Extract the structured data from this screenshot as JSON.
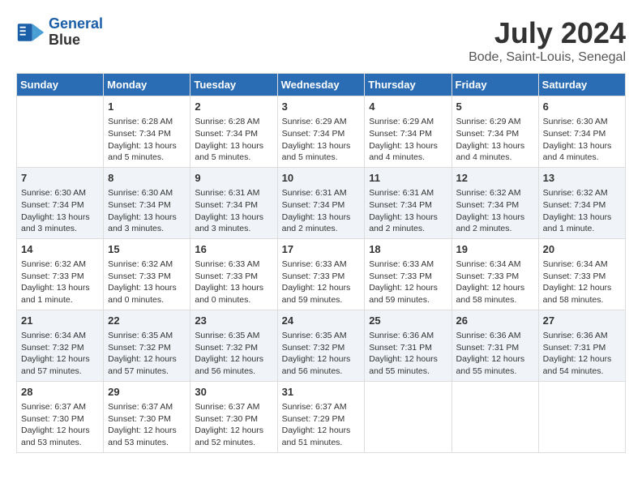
{
  "header": {
    "logo_line1": "General",
    "logo_line2": "Blue",
    "month_year": "July 2024",
    "location": "Bode, Saint-Louis, Senegal"
  },
  "days_of_week": [
    "Sunday",
    "Monday",
    "Tuesday",
    "Wednesday",
    "Thursday",
    "Friday",
    "Saturday"
  ],
  "weeks": [
    [
      {
        "day": "",
        "text": ""
      },
      {
        "day": "1",
        "text": "Sunrise: 6:28 AM\nSunset: 7:34 PM\nDaylight: 13 hours\nand 5 minutes."
      },
      {
        "day": "2",
        "text": "Sunrise: 6:28 AM\nSunset: 7:34 PM\nDaylight: 13 hours\nand 5 minutes."
      },
      {
        "day": "3",
        "text": "Sunrise: 6:29 AM\nSunset: 7:34 PM\nDaylight: 13 hours\nand 5 minutes."
      },
      {
        "day": "4",
        "text": "Sunrise: 6:29 AM\nSunset: 7:34 PM\nDaylight: 13 hours\nand 4 minutes."
      },
      {
        "day": "5",
        "text": "Sunrise: 6:29 AM\nSunset: 7:34 PM\nDaylight: 13 hours\nand 4 minutes."
      },
      {
        "day": "6",
        "text": "Sunrise: 6:30 AM\nSunset: 7:34 PM\nDaylight: 13 hours\nand 4 minutes."
      }
    ],
    [
      {
        "day": "7",
        "text": "Sunrise: 6:30 AM\nSunset: 7:34 PM\nDaylight: 13 hours\nand 3 minutes."
      },
      {
        "day": "8",
        "text": "Sunrise: 6:30 AM\nSunset: 7:34 PM\nDaylight: 13 hours\nand 3 minutes."
      },
      {
        "day": "9",
        "text": "Sunrise: 6:31 AM\nSunset: 7:34 PM\nDaylight: 13 hours\nand 3 minutes."
      },
      {
        "day": "10",
        "text": "Sunrise: 6:31 AM\nSunset: 7:34 PM\nDaylight: 13 hours\nand 2 minutes."
      },
      {
        "day": "11",
        "text": "Sunrise: 6:31 AM\nSunset: 7:34 PM\nDaylight: 13 hours\nand 2 minutes."
      },
      {
        "day": "12",
        "text": "Sunrise: 6:32 AM\nSunset: 7:34 PM\nDaylight: 13 hours\nand 2 minutes."
      },
      {
        "day": "13",
        "text": "Sunrise: 6:32 AM\nSunset: 7:34 PM\nDaylight: 13 hours\nand 1 minute."
      }
    ],
    [
      {
        "day": "14",
        "text": "Sunrise: 6:32 AM\nSunset: 7:33 PM\nDaylight: 13 hours\nand 1 minute."
      },
      {
        "day": "15",
        "text": "Sunrise: 6:32 AM\nSunset: 7:33 PM\nDaylight: 13 hours\nand 0 minutes."
      },
      {
        "day": "16",
        "text": "Sunrise: 6:33 AM\nSunset: 7:33 PM\nDaylight: 13 hours\nand 0 minutes."
      },
      {
        "day": "17",
        "text": "Sunrise: 6:33 AM\nSunset: 7:33 PM\nDaylight: 12 hours\nand 59 minutes."
      },
      {
        "day": "18",
        "text": "Sunrise: 6:33 AM\nSunset: 7:33 PM\nDaylight: 12 hours\nand 59 minutes."
      },
      {
        "day": "19",
        "text": "Sunrise: 6:34 AM\nSunset: 7:33 PM\nDaylight: 12 hours\nand 58 minutes."
      },
      {
        "day": "20",
        "text": "Sunrise: 6:34 AM\nSunset: 7:33 PM\nDaylight: 12 hours\nand 58 minutes."
      }
    ],
    [
      {
        "day": "21",
        "text": "Sunrise: 6:34 AM\nSunset: 7:32 PM\nDaylight: 12 hours\nand 57 minutes."
      },
      {
        "day": "22",
        "text": "Sunrise: 6:35 AM\nSunset: 7:32 PM\nDaylight: 12 hours\nand 57 minutes."
      },
      {
        "day": "23",
        "text": "Sunrise: 6:35 AM\nSunset: 7:32 PM\nDaylight: 12 hours\nand 56 minutes."
      },
      {
        "day": "24",
        "text": "Sunrise: 6:35 AM\nSunset: 7:32 PM\nDaylight: 12 hours\nand 56 minutes."
      },
      {
        "day": "25",
        "text": "Sunrise: 6:36 AM\nSunset: 7:31 PM\nDaylight: 12 hours\nand 55 minutes."
      },
      {
        "day": "26",
        "text": "Sunrise: 6:36 AM\nSunset: 7:31 PM\nDaylight: 12 hours\nand 55 minutes."
      },
      {
        "day": "27",
        "text": "Sunrise: 6:36 AM\nSunset: 7:31 PM\nDaylight: 12 hours\nand 54 minutes."
      }
    ],
    [
      {
        "day": "28",
        "text": "Sunrise: 6:37 AM\nSunset: 7:30 PM\nDaylight: 12 hours\nand 53 minutes."
      },
      {
        "day": "29",
        "text": "Sunrise: 6:37 AM\nSunset: 7:30 PM\nDaylight: 12 hours\nand 53 minutes."
      },
      {
        "day": "30",
        "text": "Sunrise: 6:37 AM\nSunset: 7:30 PM\nDaylight: 12 hours\nand 52 minutes."
      },
      {
        "day": "31",
        "text": "Sunrise: 6:37 AM\nSunset: 7:29 PM\nDaylight: 12 hours\nand 51 minutes."
      },
      {
        "day": "",
        "text": ""
      },
      {
        "day": "",
        "text": ""
      },
      {
        "day": "",
        "text": ""
      }
    ]
  ]
}
